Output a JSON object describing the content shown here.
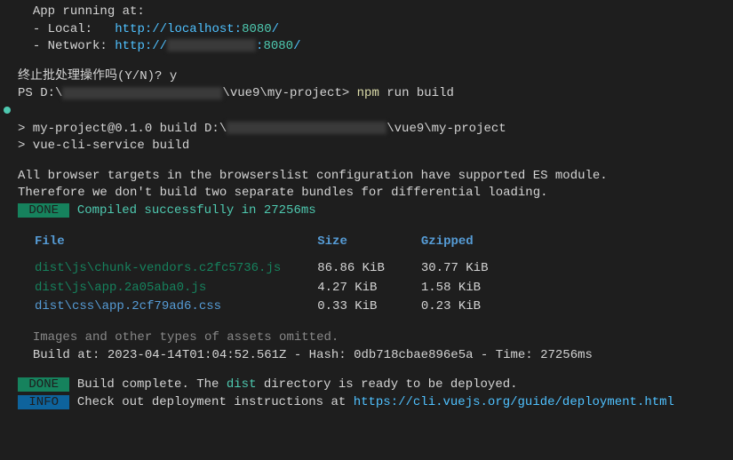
{
  "app_running": {
    "header": "App running at:",
    "local_label": "- Local:   ",
    "local_url_prefix": "http://localhost:",
    "local_port": "8080",
    "local_url_suffix": "/",
    "network_label": "- Network: ",
    "network_url_prefix": "http://",
    "network_port": "8080",
    "network_url_suffix": "/"
  },
  "prompt": {
    "terminate_question": "终止批处理操作吗(Y/N)? ",
    "terminate_answer": "y",
    "ps_prefix": "PS D:\\",
    "ps_path_end": "\\vue9\\my-project> ",
    "npm_cmd": "npm",
    "npm_args": " run build"
  },
  "build_header": {
    "package_line_a": "> my-project@0.1.0 build D:\\",
    "package_line_b": "\\vue9\\my-project",
    "cli_line": "> vue-cli-service build"
  },
  "body": {
    "line1": "All browser targets in the browserslist configuration have supported ES module.",
    "line2": "Therefore we don't build two separate bundles for differential loading.",
    "done_badge": " DONE ",
    "compiled_msg": " Compiled successfully in 27256ms"
  },
  "table": {
    "headers": {
      "file": "File",
      "size": "Size",
      "gzipped": "Gzipped"
    },
    "rows": [
      {
        "file": "dist\\js\\chunk-vendors.c2fc5736.js",
        "cls": "file-green",
        "size": "86.86 KiB",
        "gzipped": "30.77 KiB"
      },
      {
        "file": "dist\\js\\app.2a05aba0.js",
        "cls": "file-green",
        "size": "4.27 KiB",
        "gzipped": "1.58 KiB"
      },
      {
        "file": "dist\\css\\app.2cf79ad6.css",
        "cls": "file-blue",
        "size": "0.33 KiB",
        "gzipped": "0.23 KiB"
      }
    ]
  },
  "footer": {
    "assets_omitted": "Images and other types of assets omitted.",
    "build_meta": "Build at: 2023-04-14T01:04:52.561Z - Hash: 0db718cbae896e5a - Time: 27256ms",
    "done_badge": " DONE ",
    "done_text_a": " Build complete. The ",
    "done_dist": "dist",
    "done_text_b": " directory is ready to be deployed.",
    "info_badge": " INFO ",
    "info_text": " Check out deployment instructions at ",
    "info_url": "https://cli.vuejs.org/guide/deployment.html"
  }
}
